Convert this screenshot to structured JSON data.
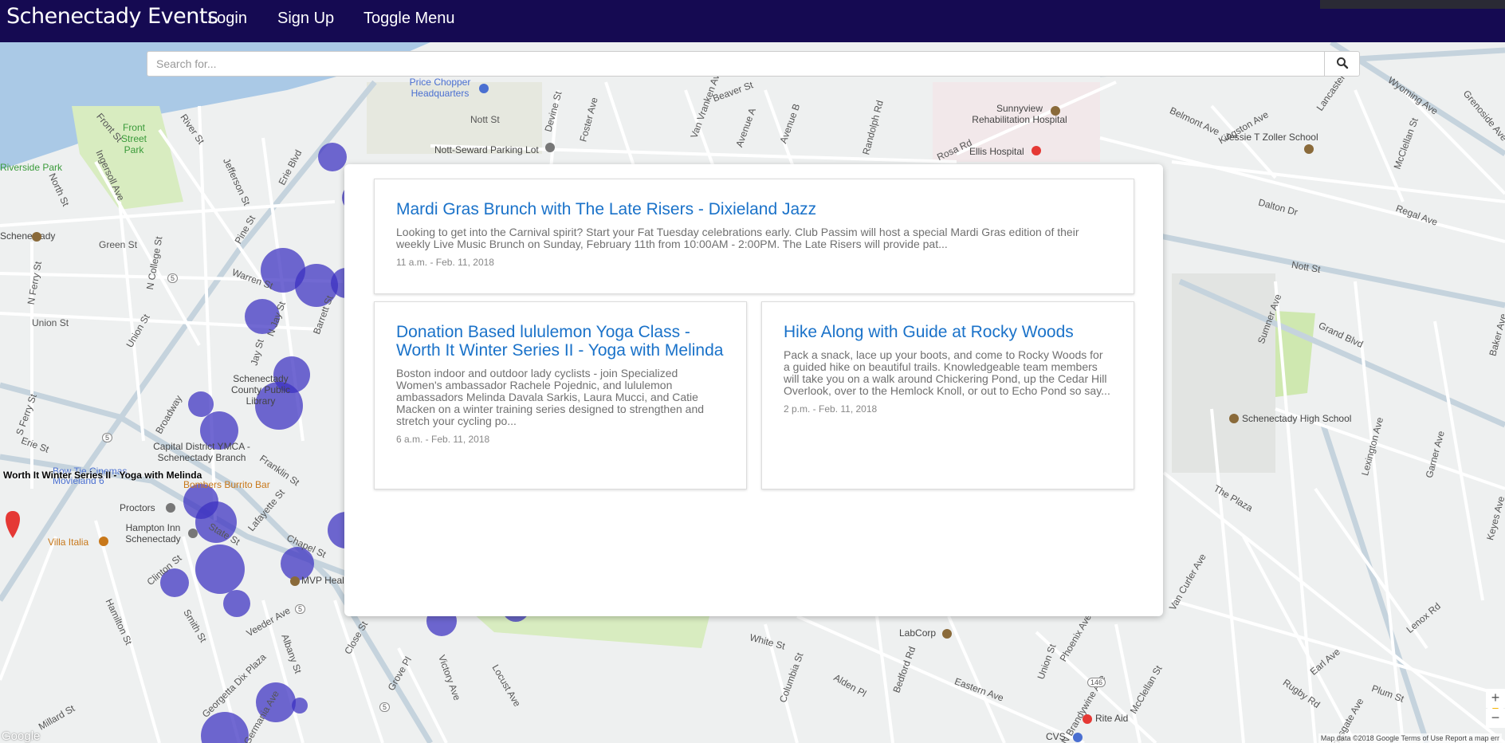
{
  "navbar": {
    "brand": "Schenectady Events",
    "login": "Login",
    "signup": "Sign Up",
    "toggle_menu": "Toggle Menu"
  },
  "search": {
    "placeholder": "Search for...",
    "button_icon": "search-icon"
  },
  "events": [
    {
      "title": "Mardi Gras Brunch with The Late Risers - Dixieland Jazz",
      "description": "Looking to get into the Carnival spirit? Start your Fat Tuesday celebrations early. Club Passim will host a special Mardi Gras edition of their weekly Live Music Brunch on Sunday, February 11th from 10:00AM - 2:00PM. The Late Risers will provide pat...",
      "meta": "11 a.m. - Feb. 11, 2018"
    },
    {
      "title": "Donation Based lululemon Yoga Class - Worth It Winter Series II - Yoga with Melinda",
      "description": "Boston indoor and outdoor lady cyclists - join Specialized Women's ambassador Rachele Pojednic, and lululemon ambassadors Melinda Davala Sarkis, Laura Mucci, and Catie Macken on a winter training series designed to strengthen and stretch your cycling po...",
      "meta": "6 a.m. - Feb. 11, 2018"
    },
    {
      "title": "Hike Along with Guide at Rocky Woods",
      "description": "Pack a snack, lace up your boots, and come to Rocky Woods for a guided hike on beautiful trails. Knowledgeable team members will take you on a walk around Chickering Pond, up the Cedar Hill Overlook, over to the Hemlock Knoll, or out to Echo Pond so say...",
      "meta": "2 p.m. - Feb. 11, 2018"
    }
  ],
  "map": {
    "marker_label": "Worth It Winter Series II - Yoga with Melinda",
    "google_logo": "Google",
    "attribution": "Map data ©2018 Google   Terms of Use   Report a map err",
    "zoom_in": "+",
    "zoom_out": "−",
    "streets": [
      {
        "name": "Front St"
      },
      {
        "name": "River St"
      },
      {
        "name": "Ingersoll Ave"
      },
      {
        "name": "North St"
      },
      {
        "name": "Jefferson St"
      },
      {
        "name": "Erie Blvd"
      },
      {
        "name": "Nott St"
      },
      {
        "name": "Devine St"
      },
      {
        "name": "Foster Ave"
      },
      {
        "name": "Van Vranken Ave"
      },
      {
        "name": "Beaver St"
      },
      {
        "name": "Avenue A"
      },
      {
        "name": "Avenue B"
      },
      {
        "name": "Randolph Rd"
      },
      {
        "name": "Rosa Rd"
      },
      {
        "name": "Belmont Ave"
      },
      {
        "name": "Kingston Ave"
      },
      {
        "name": "Lancaster St"
      },
      {
        "name": "Wyoming Ave"
      },
      {
        "name": "McClellan St"
      },
      {
        "name": "Dalton Dr"
      },
      {
        "name": "Regal Ave"
      },
      {
        "name": "Grenoside Ave"
      },
      {
        "name": "Green St"
      },
      {
        "name": "N College St"
      },
      {
        "name": "Union St"
      },
      {
        "name": "N Ferry St"
      },
      {
        "name": "Warren St"
      },
      {
        "name": "N Jay St"
      },
      {
        "name": "Barrett St"
      },
      {
        "name": "Jay St"
      },
      {
        "name": "Broadway"
      },
      {
        "name": "Erie St"
      },
      {
        "name": "S Ferry St"
      },
      {
        "name": "Franklin St"
      },
      {
        "name": "Lafayette St"
      },
      {
        "name": "State St"
      },
      {
        "name": "Chapel St"
      },
      {
        "name": "Clinton St"
      },
      {
        "name": "Smith St"
      },
      {
        "name": "Hamilton St"
      },
      {
        "name": "Veeder Ave"
      },
      {
        "name": "Albany St"
      },
      {
        "name": "Georgetta Dix Plaza"
      },
      {
        "name": "Germania Ave"
      },
      {
        "name": "Millard St"
      },
      {
        "name": "Close St"
      },
      {
        "name": "Grove Pl"
      },
      {
        "name": "Victory Ave"
      },
      {
        "name": "Locust Ave"
      },
      {
        "name": "White St"
      },
      {
        "name": "Columbia St"
      },
      {
        "name": "Alden Pl"
      },
      {
        "name": "Bedford Rd"
      },
      {
        "name": "Eastern Ave"
      },
      {
        "name": "Union St"
      },
      {
        "name": "N Brandywine Ave"
      },
      {
        "name": "McClellan St"
      },
      {
        "name": "Phoenix Ave"
      },
      {
        "name": "Sumner Ave"
      },
      {
        "name": "Lexington Ave"
      },
      {
        "name": "Garner Ave"
      },
      {
        "name": "Baker Ave"
      },
      {
        "name": "Keyes Ave"
      },
      {
        "name": "Grand Blvd"
      },
      {
        "name": "Nott St"
      },
      {
        "name": "The Plaza"
      },
      {
        "name": "Van Curler Ave"
      },
      {
        "name": "Rugby Rd"
      },
      {
        "name": "Earl Ave"
      },
      {
        "name": "Plum St"
      },
      {
        "name": "Kingsgate Ave"
      },
      {
        "name": "Lenox Rd"
      },
      {
        "name": "Pine St"
      },
      {
        "name": "Union St"
      }
    ],
    "places": [
      {
        "name": "Front Street Park",
        "color": "#3a9a3a"
      },
      {
        "name": "Riverside Park",
        "color": "#3a9a3a"
      },
      {
        "name": "Price Chopper Headquarters",
        "color": "#4a6fd1"
      },
      {
        "name": "Nott-Seward Parking Lot",
        "color": "#555555"
      },
      {
        "name": "Sunnyview Rehabilitation Hospital",
        "color": "#555555"
      },
      {
        "name": "Ellis Hospital",
        "color": "#555555"
      },
      {
        "name": "Jessie T Zoller School",
        "color": "#555555"
      },
      {
        "name": "Schenectady County Public Library",
        "color": "#555555"
      },
      {
        "name": "Capital District YMCA - Schenectady Branch",
        "color": "#8a5a20"
      },
      {
        "name": "Bow Tie Cinemas Movieland 6",
        "color": "#4a6fd1"
      },
      {
        "name": "Bombers Burrito Bar",
        "color": "#c8781a"
      },
      {
        "name": "Proctors",
        "color": "#555555"
      },
      {
        "name": "Hampton Inn Schenectady",
        "color": "#555555"
      },
      {
        "name": "Villa Italia",
        "color": "#c8781a"
      },
      {
        "name": "MVP Healt",
        "color": "#555555"
      },
      {
        "name": "Schenectady High School",
        "color": "#555555"
      },
      {
        "name": "LabCorp",
        "color": "#555555"
      },
      {
        "name": "Rite Aid",
        "color": "#555555"
      },
      {
        "name": "CVS",
        "color": "#555555"
      },
      {
        "name": "Schenectady",
        "color": "#555555"
      }
    ],
    "route_shields": [
      "5",
      "5",
      "5",
      "5",
      "146"
    ]
  },
  "colors": {
    "navbar": "#150a52",
    "link": "#1a72c9",
    "bubble": "#3a2fc0",
    "water": "#aac9e6",
    "park": "#cfe8b0"
  }
}
